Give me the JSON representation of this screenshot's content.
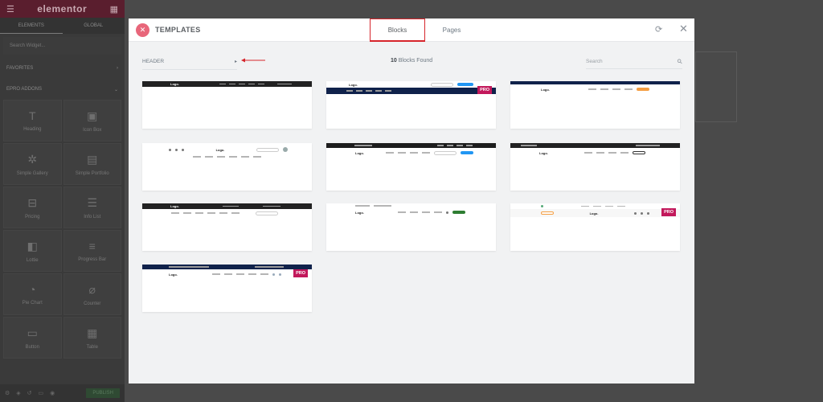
{
  "editor": {
    "brand": "elementor",
    "tabs": [
      "ELEMENTS",
      "GLOBAL"
    ],
    "search_placeholder": "Search Widget...",
    "section_favorites": "FAVORITES",
    "section_addons": "EPRO ADDONS",
    "widgets": [
      "Heading",
      "Icon Box",
      "Simple Gallery",
      "Simple Portfolio",
      "Pricing",
      "Info List",
      "Lottie",
      "Progress Bar",
      "Pie Chart",
      "Counter",
      "Button",
      "Table"
    ],
    "publish_label": "PUBLISH"
  },
  "modal": {
    "title": "TEMPLATES",
    "tabs": {
      "blocks": "Blocks",
      "pages": "Pages"
    },
    "active_tab": "Blocks",
    "category": "HEADER",
    "count_number": "10",
    "count_label": "Blocks Found",
    "search_placeholder": "Search",
    "pro_label": "PRO",
    "icons": {
      "brand": "elementskit-logo-icon",
      "sync": "sync-icon",
      "close": "close-icon",
      "search": "search-icon",
      "caret": "caret-right-icon"
    },
    "colors": {
      "accent": "#d6252b",
      "pro": "#c2185b",
      "brand": "#e8667a",
      "annotation": "#d6252b"
    }
  },
  "cards": [
    {
      "logo": "Logo."
    },
    {
      "logo": "Logo."
    },
    {
      "logo": "Logo."
    },
    {
      "logo": "Logo."
    },
    {
      "logo": "Logo."
    },
    {
      "logo": "Logo."
    },
    {
      "logo": "Logo."
    },
    {
      "logo": "Logo."
    },
    {
      "logo": "Logo."
    },
    {
      "logo": "Logo."
    }
  ]
}
